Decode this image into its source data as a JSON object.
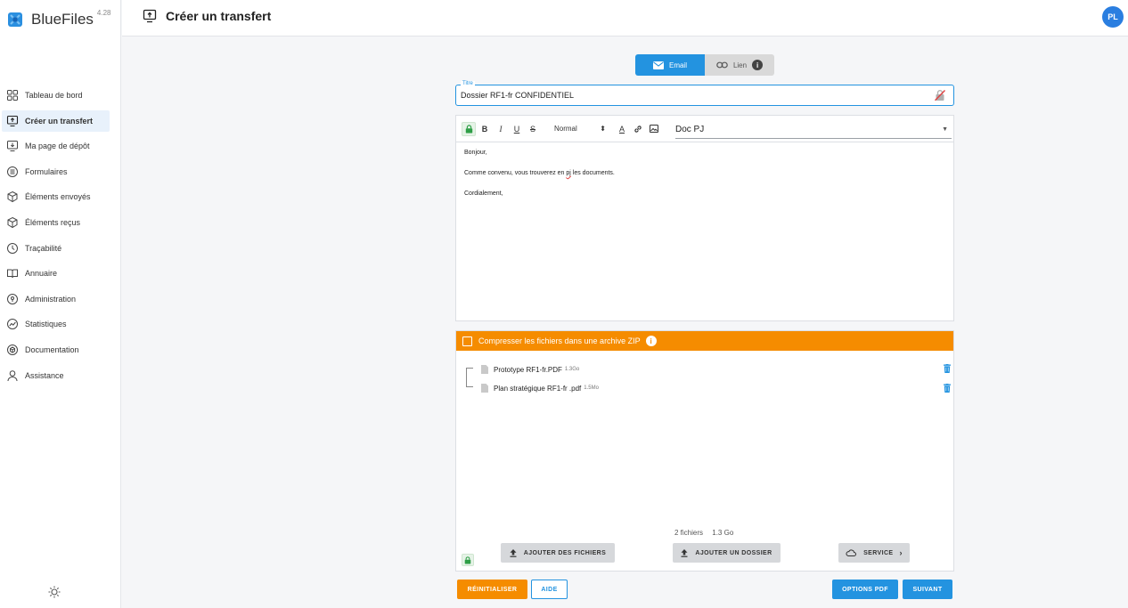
{
  "app": {
    "name": "BlueFiles",
    "version": "4.28"
  },
  "header": {
    "title": "Créer un transfert",
    "avatar_initials": "PL"
  },
  "sidebar": {
    "items": [
      {
        "label": "Tableau de bord",
        "icon": "dashboard-icon"
      },
      {
        "label": "Créer un transfert",
        "icon": "upload-screen-icon",
        "active": true
      },
      {
        "label": "Ma page de dépôt",
        "icon": "download-screen-icon"
      },
      {
        "label": "Formulaires",
        "icon": "list-icon"
      },
      {
        "label": "Éléments envoyés",
        "icon": "box-out-icon"
      },
      {
        "label": "Éléments reçus",
        "icon": "box-in-icon"
      },
      {
        "label": "Traçabilité",
        "icon": "clock-icon"
      },
      {
        "label": "Annuaire",
        "icon": "book-icon"
      },
      {
        "label": "Administration",
        "icon": "shield-icon"
      },
      {
        "label": "Statistiques",
        "icon": "chart-icon"
      },
      {
        "label": "Documentation",
        "icon": "package-icon"
      },
      {
        "label": "Assistance",
        "icon": "person-icon"
      }
    ]
  },
  "mode": {
    "email_label": "Email",
    "lien_label": "Lien",
    "info": "i"
  },
  "title_field": {
    "label": "Titre",
    "value": "Dossier RF1-fr CONFIDENTIEL"
  },
  "editor": {
    "toolbar": {
      "bold": "B",
      "italic": "I",
      "underline": "U",
      "strike": "S",
      "style": "Normal",
      "color": "A"
    },
    "template": "Doc PJ",
    "body": {
      "line1": "Bonjour,",
      "line2_a": "Comme convenu, vous trouverez en ",
      "line2_b": "pj",
      "line2_c": " les documents.",
      "line3": "Cordialement,"
    }
  },
  "files": {
    "zip_label": "Compresser les fichiers dans une archive ZIP",
    "zip_info": "i",
    "items": [
      {
        "name": "Prototype RF1-fr.PDF",
        "size": "1.3Go"
      },
      {
        "name": "Plan stratégique RF1-fr .pdf",
        "size": "1.5Mo"
      }
    ],
    "count": "2 fichiers",
    "total": "1.3 Go",
    "add_files": "AJOUTER DES FICHIERS",
    "add_folder": "AJOUTER UN DOSSIER",
    "service": "SERVICE"
  },
  "actions": {
    "reset": "RÉINITIALISER",
    "help": "AIDE",
    "pdf_options": "OPTIONS PDF",
    "next": "SUIVANT"
  },
  "colors": {
    "primary": "#2393e0",
    "accent": "#f58c00",
    "secure": "#2e9e46"
  }
}
